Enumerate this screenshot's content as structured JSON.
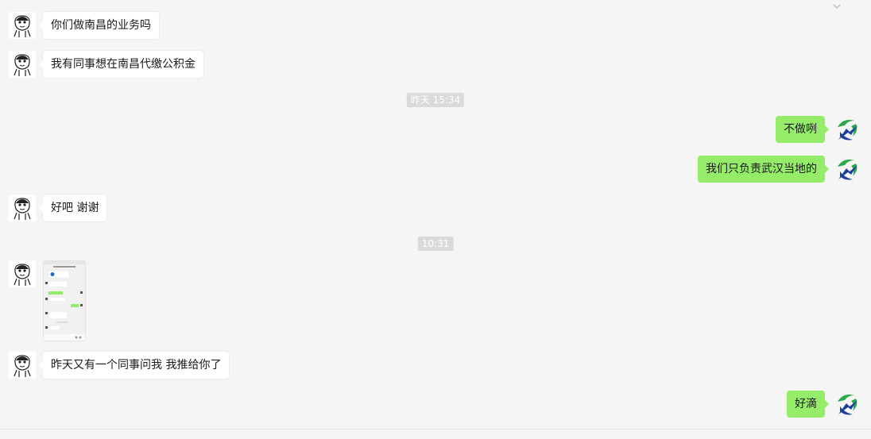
{
  "messages": [
    {
      "side": "left",
      "kind": "text",
      "text": "你们做南昌的业务吗"
    },
    {
      "side": "left",
      "kind": "text",
      "text": "我有同事想在南昌代缴公积金"
    },
    {
      "kind": "time",
      "text": "昨天 15:34"
    },
    {
      "side": "right",
      "kind": "text",
      "text": "不做咧"
    },
    {
      "side": "right",
      "kind": "text",
      "text": "我们只负责武汉当地的"
    },
    {
      "side": "left",
      "kind": "text",
      "text": "好吧 谢谢"
    },
    {
      "kind": "time",
      "text": "10:31"
    },
    {
      "side": "left",
      "kind": "image",
      "image": "chat-screenshot-thumbnail"
    },
    {
      "side": "left",
      "kind": "text",
      "text": "昨天又有一个同事问我 我推给你了"
    },
    {
      "side": "right",
      "kind": "text",
      "text": "好滴"
    }
  ],
  "colors": {
    "background": "#f5f5f5",
    "bubble_self": "#95ec69",
    "bubble_other": "#ffffff",
    "timestamp_bg": "#dadada"
  },
  "avatars": {
    "other": "cartoon-boy-avatar",
    "self": "company-logo-avatar"
  }
}
